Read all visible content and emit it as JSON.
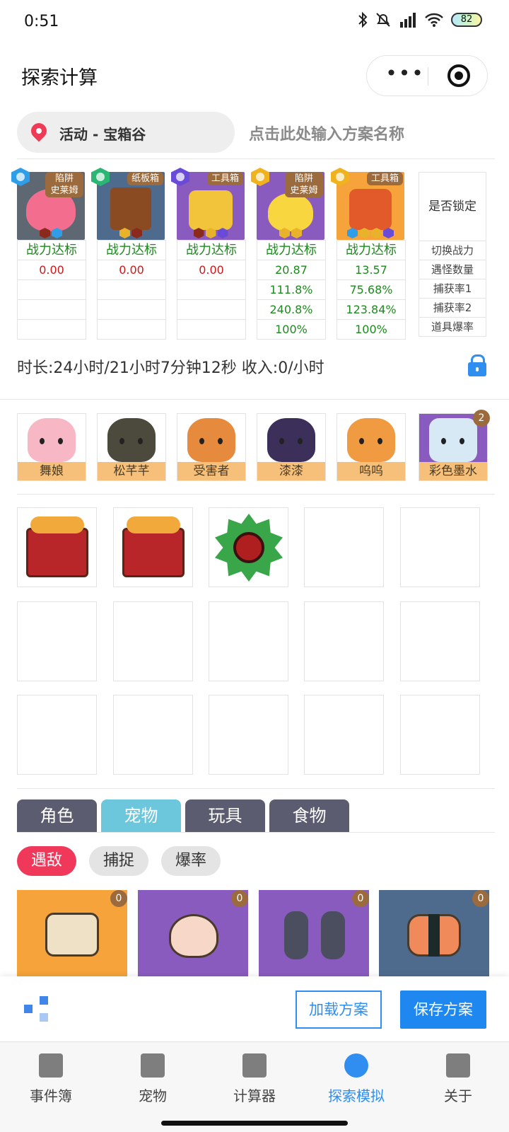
{
  "status_bar": {
    "time": "0:51",
    "battery": "82"
  },
  "header": {
    "title": "探索计算",
    "more_label": "•••"
  },
  "location": {
    "label": "活动 - 宝箱谷"
  },
  "plan_name_placeholder": "点击此处输入方案名称",
  "pet_columns": [
    {
      "tag": "陷阱\n史莱姆",
      "status": "战力达标",
      "power": "0.00",
      "rate1": "",
      "rate2": "",
      "drop": ""
    },
    {
      "tag": "纸板箱",
      "status": "战力达标",
      "power": "0.00",
      "rate1": "",
      "rate2": "",
      "drop": ""
    },
    {
      "tag": "工具箱",
      "status": "战力达标",
      "power": "0.00",
      "rate1": "",
      "rate2": "",
      "drop": ""
    },
    {
      "tag": "陷阱\n史莱姆",
      "status": "战力达标",
      "power": "20.87",
      "rate1": "111.8%",
      "rate2": "240.8%",
      "drop": "100%"
    },
    {
      "tag": "工具箱",
      "status": "战力达标",
      "power": "13.57",
      "rate1": "75.68%",
      "rate2": "123.84%",
      "drop": "100%"
    }
  ],
  "lock_column": {
    "header": "是否锁定",
    "rows": [
      "切换战力",
      "遇怪数量",
      "捕获率1",
      "捕获率2",
      "道具爆率"
    ]
  },
  "duration_text": "时长:24小时/21小时7分钟12秒 收入:0/小时",
  "team": [
    {
      "name": "舞娘"
    },
    {
      "name": "松芊芊"
    },
    {
      "name": "受害者"
    },
    {
      "name": "漆漆"
    },
    {
      "name": "呜呜"
    },
    {
      "name": "彩色墨水",
      "count": "2"
    }
  ],
  "category_tabs": [
    "角色",
    "宠物",
    "玩具",
    "食物"
  ],
  "filter_chips": [
    "遇敌",
    "捕捉",
    "爆率"
  ],
  "pet_cards": [
    {
      "count": "0"
    },
    {
      "count": "0"
    },
    {
      "count": "0"
    },
    {
      "count": "0"
    }
  ],
  "actions": {
    "load": "加载方案",
    "save": "保存方案"
  },
  "tabbar": [
    "事件簿",
    "宠物",
    "计算器",
    "探索模拟",
    "关于"
  ],
  "colors": {
    "accent": "#2f8ef0",
    "chip_active": "#f0385a",
    "tab_active": "#6cc6dc"
  }
}
